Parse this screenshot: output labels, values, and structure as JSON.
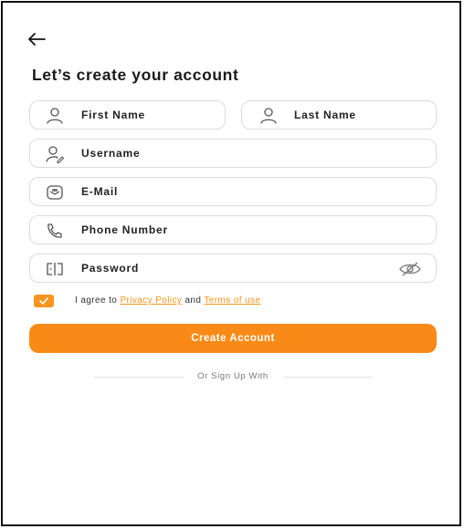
{
  "page": {
    "title": "Let’s create your account"
  },
  "form": {
    "first_name_placeholder": "First Name",
    "last_name_placeholder": "Last Name",
    "username_placeholder": "Username",
    "email_placeholder": "E-Mail",
    "phone_placeholder": "Phone Number",
    "password_placeholder": "Password"
  },
  "agreement": {
    "checked": true,
    "prefix": "I agree to ",
    "privacy_link": "Privacy Policy",
    "middle": " and ",
    "terms_link": "Terms of use"
  },
  "actions": {
    "create_account_label": "Create Account",
    "alt_signup_text": "Or Sign Up With"
  },
  "icons": {
    "back": "arrow-left-icon",
    "first_name": "user-icon",
    "last_name": "user-icon",
    "username": "user-edit-icon",
    "email": "mail-icon",
    "phone": "phone-icon",
    "password": "password-icon",
    "toggle_password": "eye-slash-icon",
    "checkbox": "check-icon"
  },
  "colors": {
    "accent": "#f98a17",
    "border": "#dcdcdc",
    "text": "#1d1d1d"
  }
}
